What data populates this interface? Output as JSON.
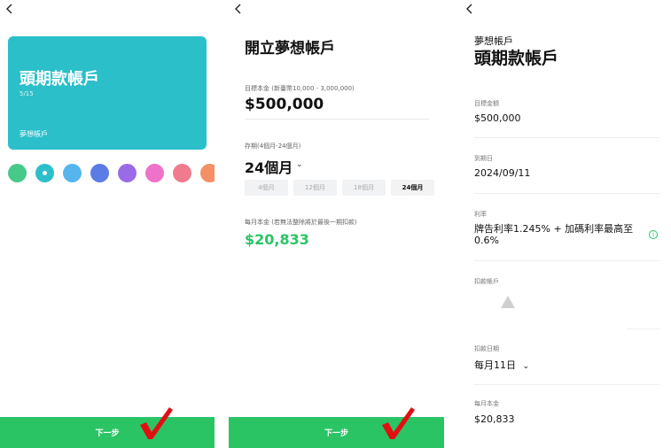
{
  "panel1": {
    "card_title": "頭期款帳戶",
    "card_progress": "5/15",
    "card_type": "夢想帳戶",
    "swatches": [
      {
        "color": "#47c98a",
        "selected": false
      },
      {
        "color": "#2bbfca",
        "selected": true
      },
      {
        "color": "#55b6ee",
        "selected": false
      },
      {
        "color": "#5b7be6",
        "selected": false
      },
      {
        "color": "#9b6ae6",
        "selected": false
      },
      {
        "color": "#ee72c8",
        "selected": false
      },
      {
        "color": "#f07b8e",
        "selected": false
      },
      {
        "color": "#f48f66",
        "selected": false
      }
    ],
    "next_label": "下一步"
  },
  "panel2": {
    "title": "開立夢想帳戶",
    "target_label": "目標本金 (新臺幣10,000 - 3,000,000)",
    "target_value": "$500,000",
    "period_label": "存期(4個月-24個月)",
    "period_value": "24個月",
    "period_options": [
      "4個月",
      "12個月",
      "18個月",
      "24個月"
    ],
    "monthly_label": "每月本金 (若無法整除將於最後一期扣款)",
    "monthly_value": "$20,833",
    "next_label": "下一步"
  },
  "panel3": {
    "subtitle": "夢想帳戶",
    "title": "頭期款帳戶",
    "target_label": "目標金額",
    "target_value": "$500,000",
    "due_label": "到期日",
    "due_value": "2024/09/11",
    "rate_label": "利率",
    "rate_value": "牌告利率1.245% + 加碼利率最高至 0.6%",
    "debit_account_label": "扣款帳戶",
    "debit_date_label": "扣款日期",
    "debit_date_value": "每月11日",
    "monthly_label": "每月本金",
    "monthly_value": "$20,833"
  },
  "colors": {
    "accent_green": "#2ac465",
    "card_teal": "#2bbfca",
    "check_red": "#e10f12"
  }
}
